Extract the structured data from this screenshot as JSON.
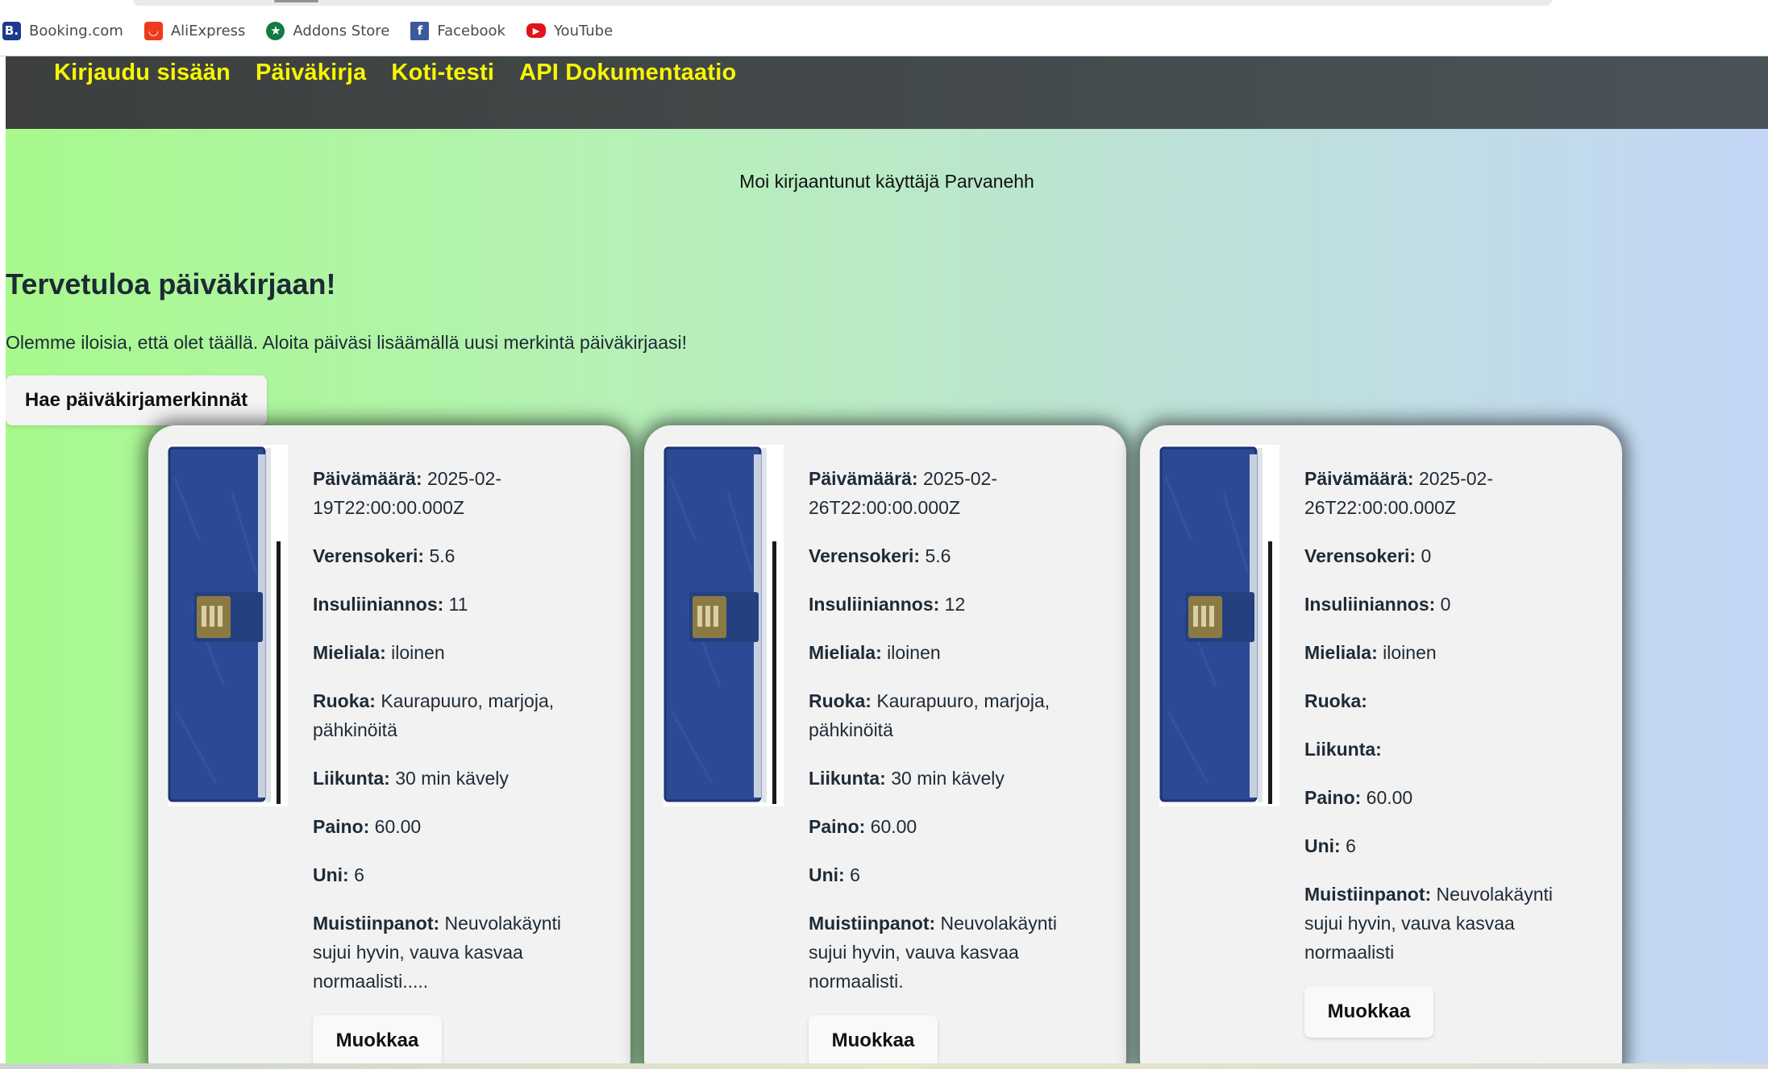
{
  "bookmarks": [
    {
      "label": "Booking.com",
      "icon": "booking-icon",
      "glyph": "B."
    },
    {
      "label": "AliExpress",
      "icon": "aliexpress-icon",
      "glyph": "◡"
    },
    {
      "label": "Addons Store",
      "icon": "addons-store-icon",
      "glyph": "★"
    },
    {
      "label": "Facebook",
      "icon": "facebook-icon",
      "glyph": "f"
    },
    {
      "label": "YouTube",
      "icon": "youtube-icon",
      "glyph": "▶"
    }
  ],
  "nav": {
    "login": "Kirjaudu sisään",
    "diary": "Päiväkirja",
    "home_test": "Koti-testi",
    "api_docs": "API Dokumentaatio"
  },
  "greeting": "Moi kirjaantunut käyttäjä Parvanehh",
  "title": "Tervetuloa päiväkirjaan!",
  "intro": "Olemme iloisia, että olet täällä. Aloita päiväsi lisäämällä uusi merkintä päiväkirjaasi!",
  "fetch_button": "Hae päiväkirjamerkinnät",
  "labels": {
    "date": "Päivämäärä:",
    "blood_sugar": "Verensokeri:",
    "insulin": "Insuliiniannos:",
    "mood": "Mieliala:",
    "food": "Ruoka:",
    "exercise": "Liikunta:",
    "weight": "Paino:",
    "sleep": "Uni:",
    "notes": "Muistiinpanot:"
  },
  "edit_button": "Muokkaa",
  "entries": [
    {
      "date": "2025-02-19T22:00:00.000Z",
      "blood_sugar": "5.6",
      "insulin": "11",
      "mood": "iloinen",
      "food": "Kaurapuuro, marjoja, pähkinöitä",
      "exercise": "30 min kävely",
      "weight": "60.00",
      "sleep": "6",
      "notes": "Neuvolakäynti sujui hyvin, vauva kasvaa normaalisti....."
    },
    {
      "date": "2025-02-26T22:00:00.000Z",
      "blood_sugar": "5.6",
      "insulin": "12",
      "mood": "iloinen",
      "food": "Kaurapuuro, marjoja, pähkinöitä",
      "exercise": "30 min kävely",
      "weight": "60.00",
      "sleep": "6",
      "notes": "Neuvolakäynti sujui hyvin, vauva kasvaa normaalisti."
    },
    {
      "date": "2025-02-26T22:00:00.000Z",
      "blood_sugar": "0",
      "insulin": "0",
      "mood": "iloinen",
      "food": "",
      "exercise": "",
      "weight": "60.00",
      "sleep": "6",
      "notes": "Neuvolakäynti sujui hyvin, vauva kasvaa normaalisti"
    }
  ],
  "colors": {
    "nav_link": "#f7f700",
    "navbar": "#3c3f3e",
    "card": "#f2f2f2",
    "notebook_cover": "#2b4a95"
  }
}
